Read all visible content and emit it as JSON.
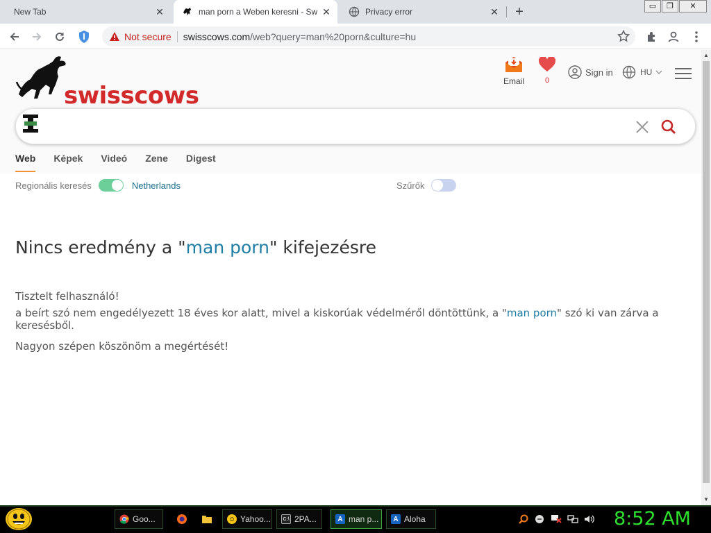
{
  "browser": {
    "tabs": [
      {
        "label": "New Tab",
        "close": "✕"
      },
      {
        "label": "man porn a Weben keresni - Swi",
        "close": "✕"
      },
      {
        "label": "Privacy error",
        "close": "✕"
      }
    ],
    "new_tab": "+",
    "window_buttons": {
      "minimize": "▭",
      "restore": "❐",
      "close": "✕"
    },
    "address": {
      "security_text": "Not secure",
      "host": "swisscows.com",
      "path": "/web?query=man%20porn&culture=hu"
    }
  },
  "site": {
    "logo_text": "swisscows",
    "email_label": "Email",
    "favorites_count": "0",
    "signin_label": "Sign in",
    "language": "HU",
    "search": {
      "value": ""
    },
    "verticals": [
      "Web",
      "Képek",
      "Videó",
      "Zene",
      "Digest"
    ],
    "regional_label": "Regionális keresés",
    "regional_value": "Netherlands",
    "filters_label": "Szűrők"
  },
  "content": {
    "heading_prefix": "Nincs eredmény a \"",
    "heading_query": "man porn",
    "heading_suffix": "\" kifejezésre",
    "greeting": "Tisztelt felhasználó!",
    "body_prefix": "a beírt szó nem engedélyezett 18 éves kor alatt, mivel a kiskorúak védelméről döntöttünk, a \"",
    "body_query": "man porn",
    "body_suffix": "\" szó ki van zárva a keresésből.",
    "thanks": "Nagyon szépen köszönöm a megértését!"
  },
  "taskbar": {
    "buttons": [
      {
        "label": "Goo...",
        "icon": "chrome-icon"
      },
      {
        "label": "Yahoo...",
        "icon": "yahoo-messenger-icon"
      },
      {
        "label": "2PA...",
        "icon": "cmd-icon"
      },
      {
        "label": "man p...",
        "icon": "aloha-icon"
      },
      {
        "label": "Aloha",
        "icon": "aloha-icon"
      }
    ],
    "clock": "8:52 AM"
  },
  "colors": {
    "brand_red": "#d22a2a",
    "link_blue": "#1f7ea4",
    "toggle_on": "#6ccf9a",
    "toggle_off": "#c7d3ef",
    "tab_accent": "#f09433",
    "clock_green": "#2ee02e"
  }
}
